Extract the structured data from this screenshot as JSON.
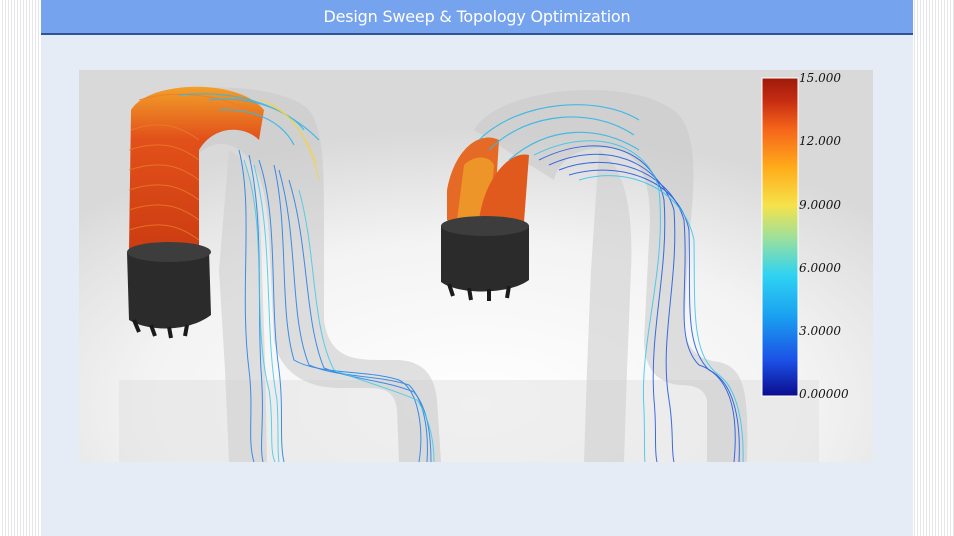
{
  "slide": {
    "title": "Design Sweep & Topology Optimization"
  },
  "figure": {
    "colorbar": {
      "ticks": [
        "15.000",
        "12.000",
        "9.0000",
        "6.0000",
        "3.0000",
        "0.00000"
      ],
      "colors": [
        "#0a0c8c",
        "#1c4fe6",
        "#1aa0f0",
        "#2fd3f2",
        "#9fe09a",
        "#f6e24a",
        "#ffab1a",
        "#f5641a",
        "#c52c12",
        "#9e1a0a"
      ]
    },
    "colors": {
      "slide_background": "#e5ecf6",
      "title_bar": "#75a3ee",
      "title_rule": "#2f5597"
    }
  }
}
